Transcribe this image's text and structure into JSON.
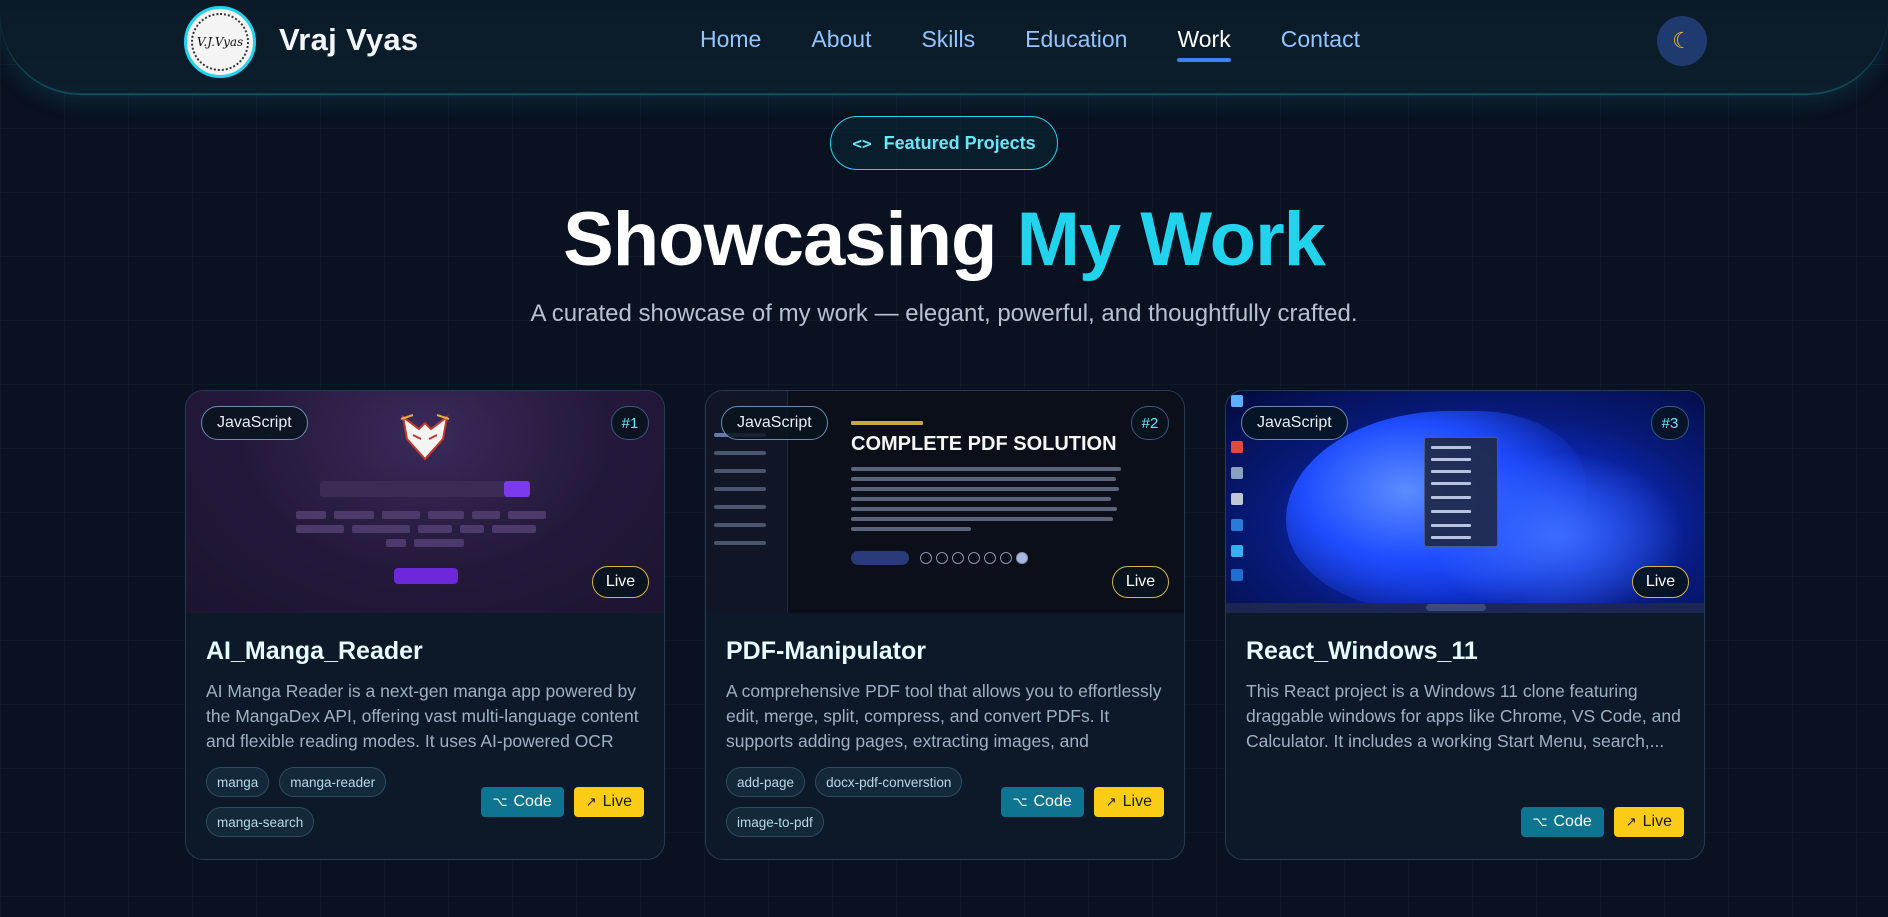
{
  "brand": {
    "logo_text": "V.J.Vyas",
    "name": "Vraj Vyas"
  },
  "nav": {
    "items": [
      {
        "label": "Home"
      },
      {
        "label": "About"
      },
      {
        "label": "Skills"
      },
      {
        "label": "Education"
      },
      {
        "label": "Work",
        "active": true
      },
      {
        "label": "Contact"
      }
    ],
    "theme_toggle_icon": "moon-icon"
  },
  "hero": {
    "pill_label": "Featured Projects",
    "pill_icon": "code-icon",
    "title_main": "Showcasing ",
    "title_accent": "My Work",
    "subtitle": "A curated showcase of my work — elegant, powerful, and thoughtfully crafted."
  },
  "colors": {
    "accent": "#22d3ee",
    "nav_link": "#93c5fd",
    "code_button": "#0e7490",
    "live_button": "#facc15",
    "background": "#0a1120"
  },
  "projects": [
    {
      "language": "JavaScript",
      "rank": "#1",
      "live_badge": "Live",
      "title": "AI_Manga_Reader",
      "description": "AI Manga Reader is a next-gen manga app powered by the MangaDex API, offering vast multi-language content and flexible reading modes. It uses AI-powered OCR to...",
      "tags": [
        "manga",
        "manga-reader",
        "manga-search"
      ],
      "code_label": "Code",
      "live_label": "Live"
    },
    {
      "language": "JavaScript",
      "rank": "#2",
      "live_badge": "Live",
      "title": "PDF-Manipulator",
      "description": "A comprehensive PDF tool that allows you to effortlessly edit, merge, split, compress, and convert PDFs. It supports adding pages, extracting images, and viewing...",
      "tags": [
        "add-page",
        "docx-pdf-converstion",
        "image-to-pdf"
      ],
      "code_label": "Code",
      "live_label": "Live",
      "preview_heading": "COMPLETE PDF SOLUTION"
    },
    {
      "language": "JavaScript",
      "rank": "#3",
      "live_badge": "Live",
      "title": "React_Windows_11",
      "description": "This React project is a Windows 11 clone featuring draggable windows for apps like Chrome, VS Code, and Calculator. It includes a working Start Menu, search,...",
      "tags": [],
      "code_label": "Code",
      "live_label": "Live"
    }
  ]
}
